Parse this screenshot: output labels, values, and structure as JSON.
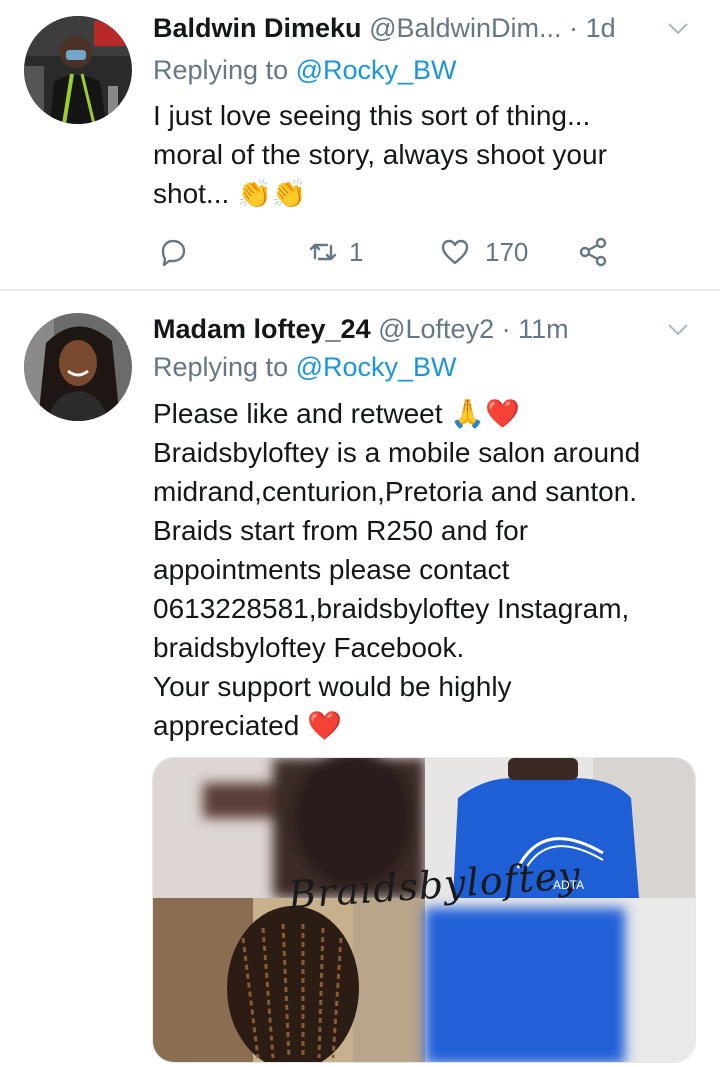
{
  "tweets": [
    {
      "name": "Baldwin Dimeku",
      "handle": "@BaldwinDim...",
      "separator": "·",
      "time": "1d",
      "reply_prefix": "Replying to",
      "reply_to": "@Rocky_BW",
      "body_lines": [
        "I just love seeing this sort of thing...",
        "moral of the story, always shoot your",
        "shot... 👏👏"
      ],
      "actions": {
        "reply_count": "",
        "retweet_count": "1",
        "like_count": "170"
      }
    },
    {
      "name": "Madam loftey_24",
      "handle": "@Loftey2",
      "separator": "·",
      "time": "11m",
      "reply_prefix": "Replying to",
      "reply_to": "@Rocky_BW",
      "body_lines": [
        "Please like and retweet 🙏❤️",
        "Braidsbyloftey is a mobile salon around",
        "midrand,centurion,Pretoria and santon.",
        "Braids start from R250 and for",
        "appointments please contact",
        "0613228581,braidsbyloftey Instagram,",
        "braidsbyloftey Facebook.",
        "Your support would be highly",
        "appreciated ❤️"
      ],
      "media": {
        "watermark": "Braidsbyloftey",
        "shirt_logo": "ADTA"
      }
    }
  ],
  "icons": {
    "reply": "reply-icon",
    "retweet": "retweet-icon",
    "like": "heart-icon",
    "share": "share-icon",
    "caret": "chevron-down-icon"
  },
  "colors": {
    "link": "#1b95e0",
    "secondary": "#657786",
    "text": "#14171a",
    "heart": "#e0245e"
  }
}
